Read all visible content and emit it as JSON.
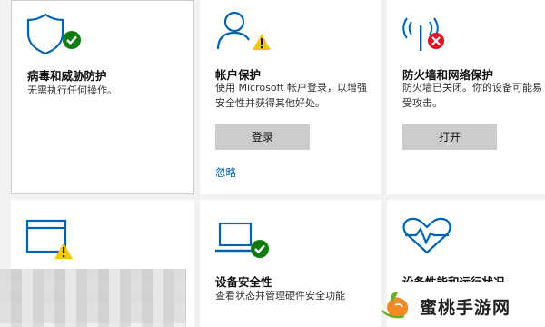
{
  "tiles": {
    "virus": {
      "title": "病毒和威胁防护",
      "desc": "无需执行任何操作。",
      "icon": "shield-check-icon"
    },
    "account": {
      "title": "帐户保护",
      "desc_line1": "使用 Microsoft 帐户登录，以增强",
      "desc_line2": "安全性并获得其他好处。",
      "button": "登录",
      "link": "忽略",
      "icon": "person-warning-icon"
    },
    "firewall": {
      "title": "防火墙和网络保护",
      "desc_line1": "防火墙已关闭。你的设备可能易",
      "desc_line2": "受攻击。",
      "button": "打开",
      "icon": "antenna-error-icon"
    },
    "app": {
      "icon": "browser-warning-icon"
    },
    "device_security": {
      "title": "设备安全性",
      "desc": "查看状态并管理硬件安全功能",
      "icon": "laptop-check-icon"
    },
    "performance": {
      "title": "设备性能和运行状况",
      "icon": "heart-pulse-icon"
    }
  },
  "watermark": {
    "text": "蜜桃手游网"
  },
  "colors": {
    "accent_blue": "#0063b1",
    "ok_green": "#107c10",
    "warn_yellow": "#f2c811",
    "error_red": "#e81123"
  }
}
